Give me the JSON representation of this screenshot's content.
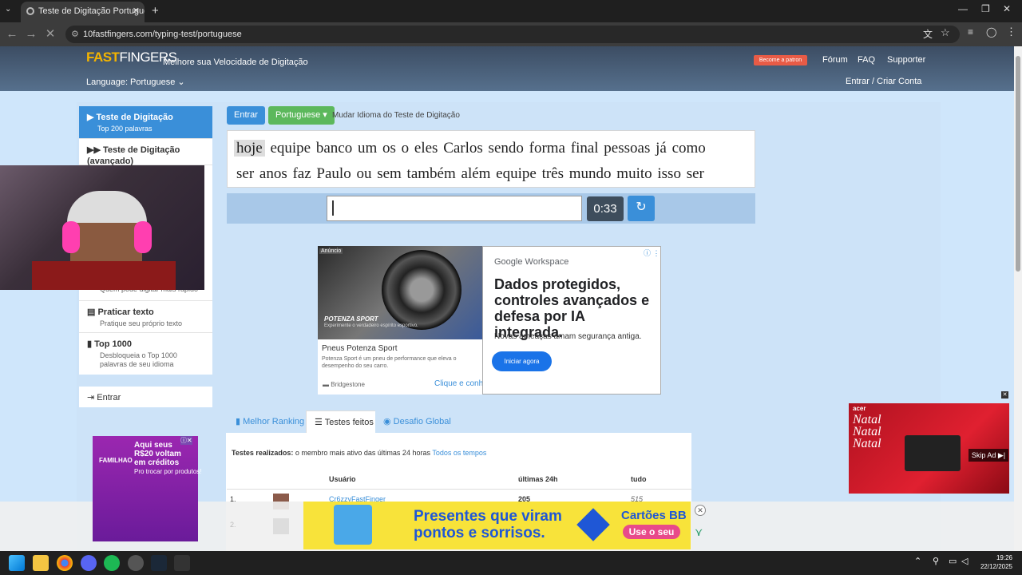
{
  "browser": {
    "tab_title": "Teste de Digitação Portuguese",
    "url": "10fastfingers.com/typing-test/portuguese"
  },
  "site": {
    "logo_text_fast": "FAST",
    "logo_text_fingers": "FINGERS",
    "tagline": "Melhore sua Velocidade de Digitação",
    "patron": "Become a patron",
    "nav": [
      "Fórum",
      "FAQ",
      "Supporter"
    ],
    "language": "Language: Portuguese",
    "login": "Entrar / Criar Conta"
  },
  "sidebar": {
    "items": [
      {
        "title": "Teste de Digitação",
        "subtitle": "Top 200 palavras"
      },
      {
        "title": "Teste de Digitação (avançado)",
        "subtitle": ""
      },
      {
        "title": "",
        "subtitle": "Quem pode digitar mais rápido"
      },
      {
        "title": "Praticar texto",
        "subtitle": "Pratique seu próprio texto"
      },
      {
        "title": "Top 1000",
        "subtitle": "Desbloqueia o Top 1000 palavras de seu idioma"
      }
    ],
    "entrar": "Entrar"
  },
  "test": {
    "entrar_btn": "Entrar",
    "lang_btn": "Portuguese",
    "mudar": "Mudar Idioma do Teste de Digitação",
    "current_word": "hoje",
    "line1_rest": "equipe banco um os o eles Carlos sendo forma final pessoas já como",
    "line2": "ser anos faz Paulo ou sem também além equipe três mundo muito isso ser",
    "input_value": "",
    "timer": "0:33"
  },
  "ad1": {
    "badge": "Anúncio",
    "img_title": "POTENZA SPORT",
    "img_sub": "Experimente o verdadeiro espírito esportivo.",
    "headline": "Pneus Potenza Sport",
    "desc": "Potenza Sport é um pneu de performance que eleva o desempenho do seu carro.",
    "brand": "Bridgestone",
    "click": "Clique e conhe",
    "google_label": "Google Workspace",
    "google_headline": "Dados protegidos, controles avançados e defesa por IA integrada.",
    "google_sub": "Novas ameaças amam segurança antiga.",
    "google_btn": "Iniciar agora"
  },
  "ranking": {
    "tabs": [
      "Melhor Ranking",
      "Testes feitos",
      "Desafio Global"
    ],
    "realizados_bold": "Testes realizados:",
    "realizados_rest": "o membro mais ativo das últimas 24 horas",
    "todos": "Todos os tempos",
    "headers": [
      "Usuário",
      "últimas 24h",
      "tudo"
    ],
    "rows": [
      {
        "rank": "1.",
        "user": "Cr6zzyFastFinger",
        "last24": "205",
        "all": "515"
      },
      {
        "rank": "2.",
        "user": "",
        "last24": "",
        "all": ""
      }
    ]
  },
  "ad2": {
    "line1": "Presentes que viram",
    "line2": "pontos e sorrisos.",
    "brand": "Cartões BB",
    "cta": "Use o seu"
  },
  "ad3": {
    "text": "Aqui seus R$20 voltam em créditos",
    "sub": "Pro trocar por produtos!",
    "brand": "FAMILHAO"
  },
  "ad4": {
    "brand": "acer",
    "text": "Natal Natal Natal",
    "skip": "Skip Ad"
  },
  "taskbar": {
    "time": "19:26",
    "date": "22/12/2025"
  },
  "colors": {
    "accent": "#3a8fd9",
    "green": "#5cb85c",
    "header": "#3c4d63"
  }
}
